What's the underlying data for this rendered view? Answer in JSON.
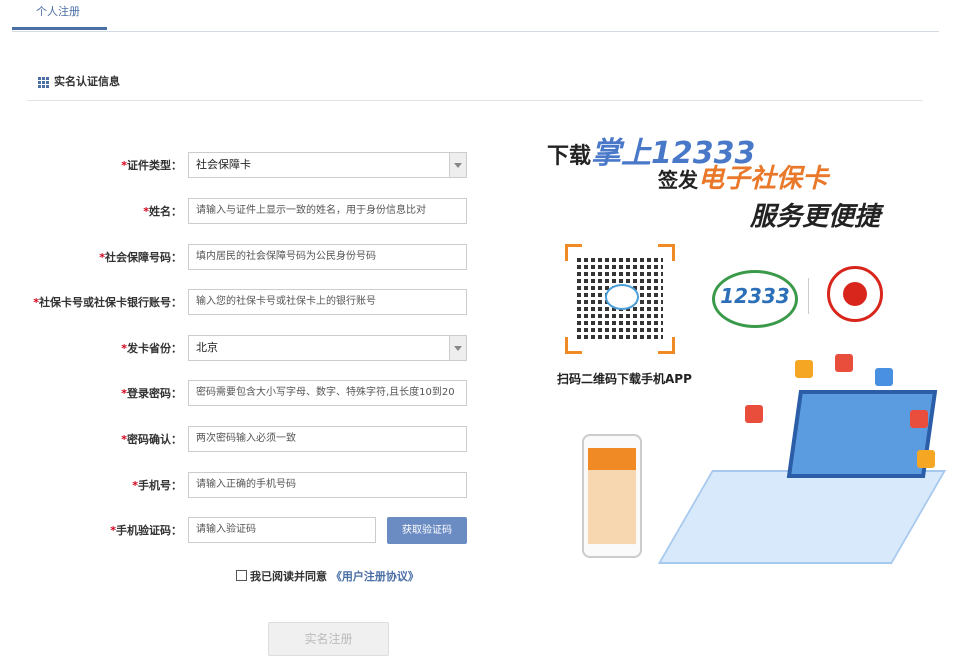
{
  "tab": {
    "label": "个人注册"
  },
  "section": {
    "title": "实名认证信息"
  },
  "form": {
    "rows": [
      {
        "label": "证件类型：",
        "value": "社会保障卡",
        "type": "select"
      },
      {
        "label": "姓名：",
        "placeholder": "请输入与证件上显示一致的姓名，用于身份信息比对"
      },
      {
        "label": "社会保障号码：",
        "placeholder": "填内居民的社会保障号码为公民身份号码"
      },
      {
        "label": "社保卡号或社保卡银行账号：",
        "placeholder": "输入您的社保卡号或社保卡上的银行账号"
      },
      {
        "label": "发卡省份：",
        "value": "北京",
        "type": "select"
      },
      {
        "label": "登录密码：",
        "placeholder": "密码需要包含大小写字母、数字、特殊字符,且长度10到20"
      },
      {
        "label": "密码确认：",
        "placeholder": "两次密码输入必须一致"
      },
      {
        "label": "手机号：",
        "placeholder": "请输入正确的手机号码"
      },
      {
        "label": "手机验证码：",
        "placeholder": "请输入验证码"
      }
    ],
    "required_mark": "*",
    "get_code_label": "获取验证码",
    "agree_text": "我已阅读并同意",
    "agree_link": "《用户注册协议》",
    "submit_label": "实名注册"
  },
  "promo": {
    "line1_prefix": "下载",
    "line1_highlight": "掌上12333",
    "line2_prefix": "签发",
    "line2_highlight": "电子社保卡",
    "line3": "服务更便捷",
    "scan_text": "扫码二维码下载手机APP",
    "logo_text": "12333"
  },
  "colors": {
    "accent": "#4a6fa5",
    "required": "#d0021b",
    "button": "#6b8cc3",
    "orange": "#f08a24"
  }
}
